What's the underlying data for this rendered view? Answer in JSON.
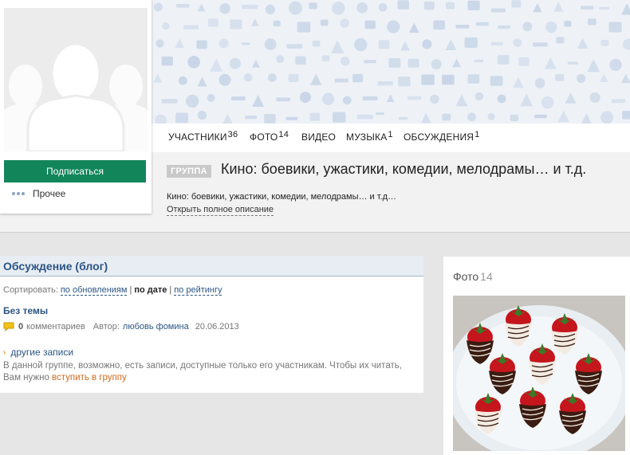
{
  "tabs": [
    {
      "label": "УЧАСТНИКИ",
      "count": "36"
    },
    {
      "label": "ФОТО",
      "count": "14"
    },
    {
      "label": "ВИДЕО",
      "count": ""
    },
    {
      "label": "МУЗЫКА",
      "count": "1"
    },
    {
      "label": "ОБСУЖДЕНИЯ",
      "count": "1"
    }
  ],
  "group": {
    "badge": "ГРУППА",
    "title": "Кино: боевики, ужастики, комедии, мелодрамы… и т.д.",
    "description": "Кино: боевики, ужастики, комедии, мелодрамы… и т.д…",
    "full_description_link": "Открыть полное описание"
  },
  "sidebar": {
    "subscribe_label": "Подписаться",
    "more_label": "Прочее"
  },
  "discussion": {
    "title": "Обсуждение (блог)",
    "sort_label": "Сортировать:",
    "sort_options": [
      "по обновлениям",
      "по дате",
      "по рейтингу"
    ],
    "sort_separator": "|",
    "topic_title": "Без темы",
    "comment_count": "0",
    "comments_label": "комментариев",
    "author_label": "Автор:",
    "author_name": "любовь фомина",
    "date": "20.06.2013",
    "other_posts_label": "другие записи",
    "notice_text": "В данной группе, возможно, есть записи, доступные только его участникам. Чтобы их читать, Вам нужно",
    "join_link": "вступить в группу"
  },
  "photo": {
    "title": "Фото",
    "count": "14"
  },
  "colors": {
    "accent_green": "#12865a",
    "link_blue": "#2b5485",
    "join_orange": "#d2691e",
    "cover_icons": "#c8d5e6"
  }
}
